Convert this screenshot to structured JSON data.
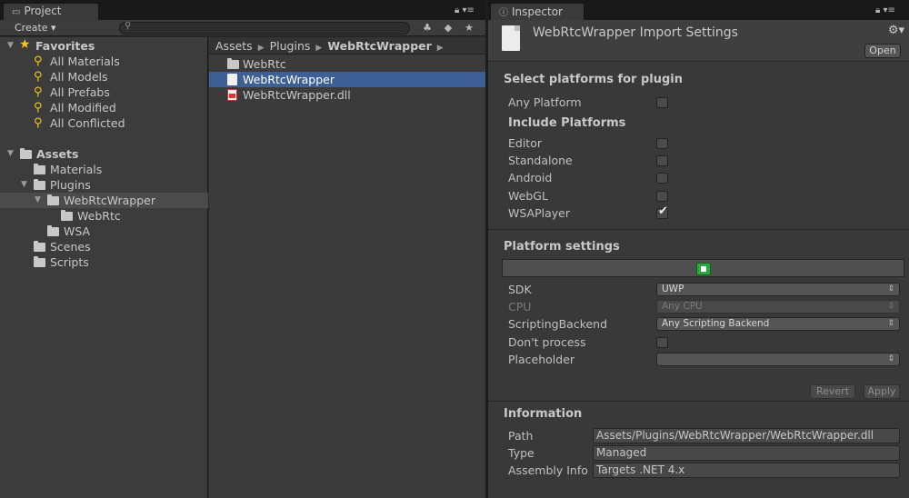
{
  "project": {
    "tab_label": "Project",
    "create_label": "Create ▾",
    "favorites": {
      "label": "Favorites",
      "items": [
        "All Materials",
        "All Models",
        "All Prefabs",
        "All Modified",
        "All Conflicted"
      ]
    },
    "assets": {
      "label": "Assets",
      "materials": "Materials",
      "plugins": "Plugins",
      "webrtcwrapper": "WebRtcWrapper",
      "webrtc": "WebRtc",
      "wsa": "WSA",
      "scenes": "Scenes",
      "scripts": "Scripts"
    },
    "breadcrumb": [
      "Assets",
      "Plugins",
      "WebRtcWrapper"
    ],
    "files": [
      "WebRtc",
      "WebRtcWrapper",
      "WebRtcWrapper.dll"
    ]
  },
  "inspector": {
    "tab_label": "Inspector",
    "title": "WebRtcWrapper Import Settings",
    "open_label": "Open",
    "select_platforms_header": "Select platforms for plugin",
    "any_platform": "Any Platform",
    "include_platforms_header": "Include Platforms",
    "platforms": [
      {
        "name": "Editor",
        "checked": false
      },
      {
        "name": "Standalone",
        "checked": false
      },
      {
        "name": "Android",
        "checked": false
      },
      {
        "name": "WebGL",
        "checked": false
      },
      {
        "name": "WSAPlayer",
        "checked": true
      }
    ],
    "platform_settings_header": "Platform settings",
    "settings": {
      "sdk_label": "SDK",
      "sdk_value": "UWP",
      "cpu_label": "CPU",
      "cpu_value": "Any CPU",
      "backend_label": "ScriptingBackend",
      "backend_value": "Any Scripting Backend",
      "dont_process_label": "Don't process",
      "placeholder_label": "Placeholder",
      "placeholder_value": ""
    },
    "revert_label": "Revert",
    "apply_label": "Apply",
    "information_header": "Information",
    "info": {
      "path_label": "Path",
      "path_value": "Assets/Plugins/WebRtcWrapper/WebRtcWrapper.dll",
      "type_label": "Type",
      "type_value": "Managed",
      "assembly_label": "Assembly Info",
      "assembly_value": "Targets .NET 4.x"
    }
  },
  "colors": {
    "selection_blue": "#3e5f96",
    "store_green": "#2aa83b",
    "favorite_yellow": "#f5c518"
  }
}
